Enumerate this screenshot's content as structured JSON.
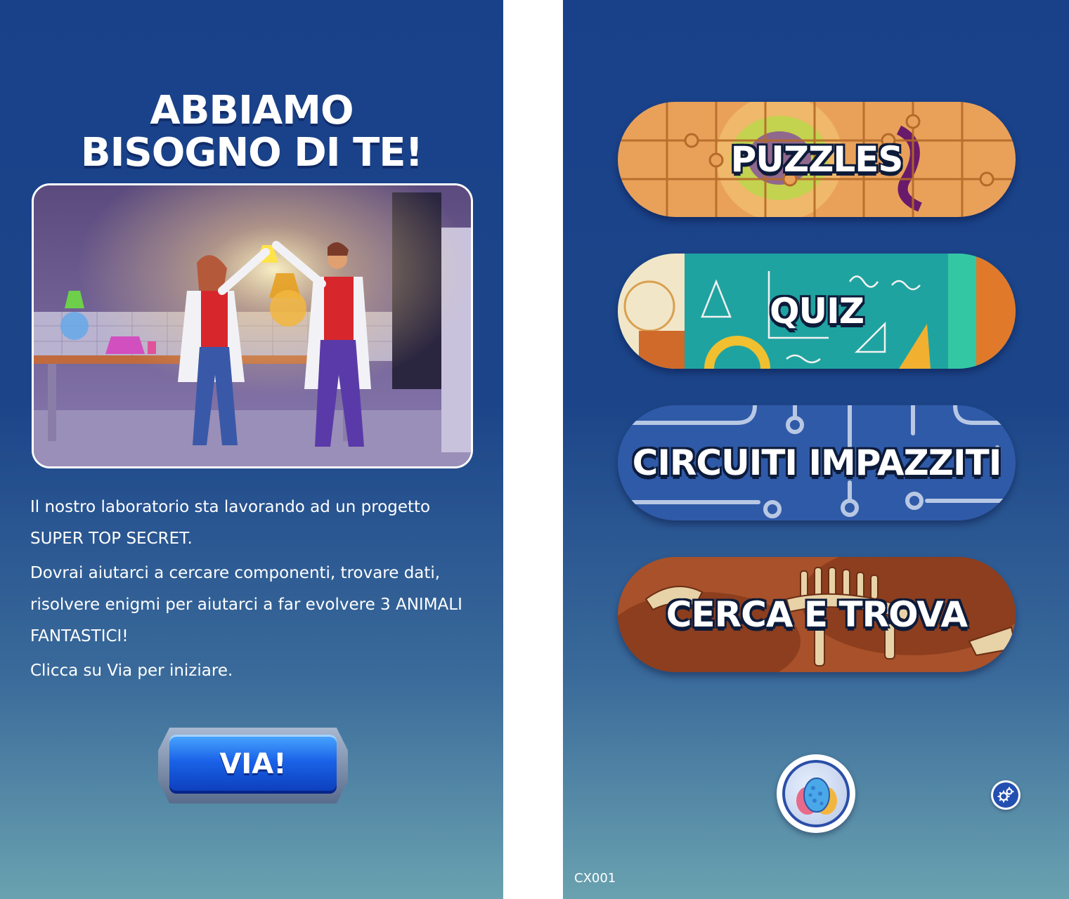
{
  "intro_screen": {
    "title_line1": "ABBIAMO",
    "title_line2": "BISOGNO DI TE!",
    "paragraphs": [
      "Il nostro laboratorio sta lavorando ad un progetto SUPER TOP SECRET.",
      "Dovrai aiutarci a cercare componenti, trovare dati, risolvere enigmi per aiutarci a far evolvere 3 ANIMALI FANTASTICI!",
      "Clicca su Via per iniziare."
    ],
    "start_button_label": "VIA!"
  },
  "menu_screen": {
    "games": [
      {
        "label": "PUZZLES"
      },
      {
        "label": "QUIZ"
      },
      {
        "label": "CIRCUITI IMPAZZITI"
      },
      {
        "label": "CERCA E TROVA"
      }
    ],
    "egg_button_icon": "egg-icon",
    "settings_icon": "gears-icon",
    "build_code": "CX001"
  },
  "colors": {
    "background_top": "#19418a",
    "background_bottom": "#6aa2b0",
    "accent_blue": "#1a62e8"
  }
}
